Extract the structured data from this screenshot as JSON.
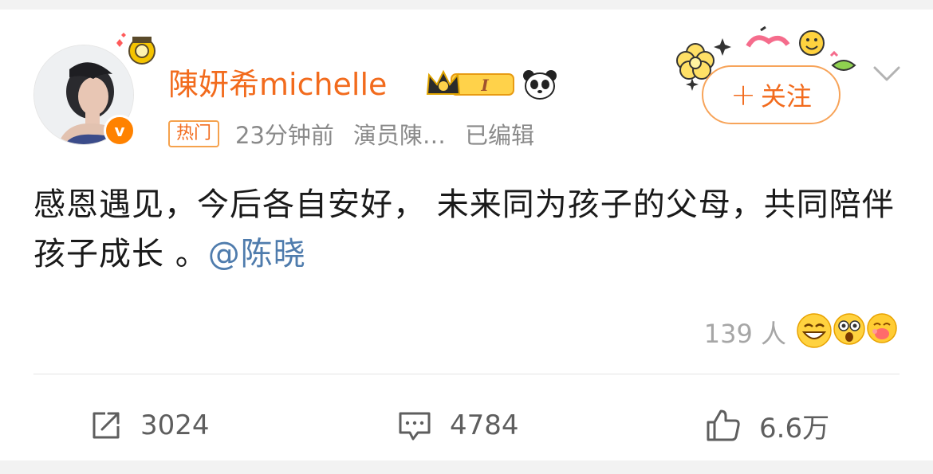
{
  "post": {
    "username": "陳妍希michelle",
    "hot_tag": "热门",
    "time": "23分钟前",
    "source": "演员陳…",
    "edited": "已编辑",
    "follow_label": "关注",
    "text_main": "感恩遇见，今后各自安好， 未来同为孩子的父母，共同陪伴孩子成长 。",
    "mention": "@陈晓"
  },
  "vip": {
    "level": "I"
  },
  "reactions": {
    "count": "139 人",
    "emojis": [
      "grinning-emoji",
      "surprised-emoji",
      "kiss-emoji"
    ]
  },
  "actions": {
    "repost_count": "3024",
    "comment_count": "4784",
    "like_count": "6.6万"
  },
  "colors": {
    "username": "#f26b1d",
    "mention": "#4f7cad",
    "verified": "#ff8200",
    "follow_border": "#f7a45a"
  }
}
